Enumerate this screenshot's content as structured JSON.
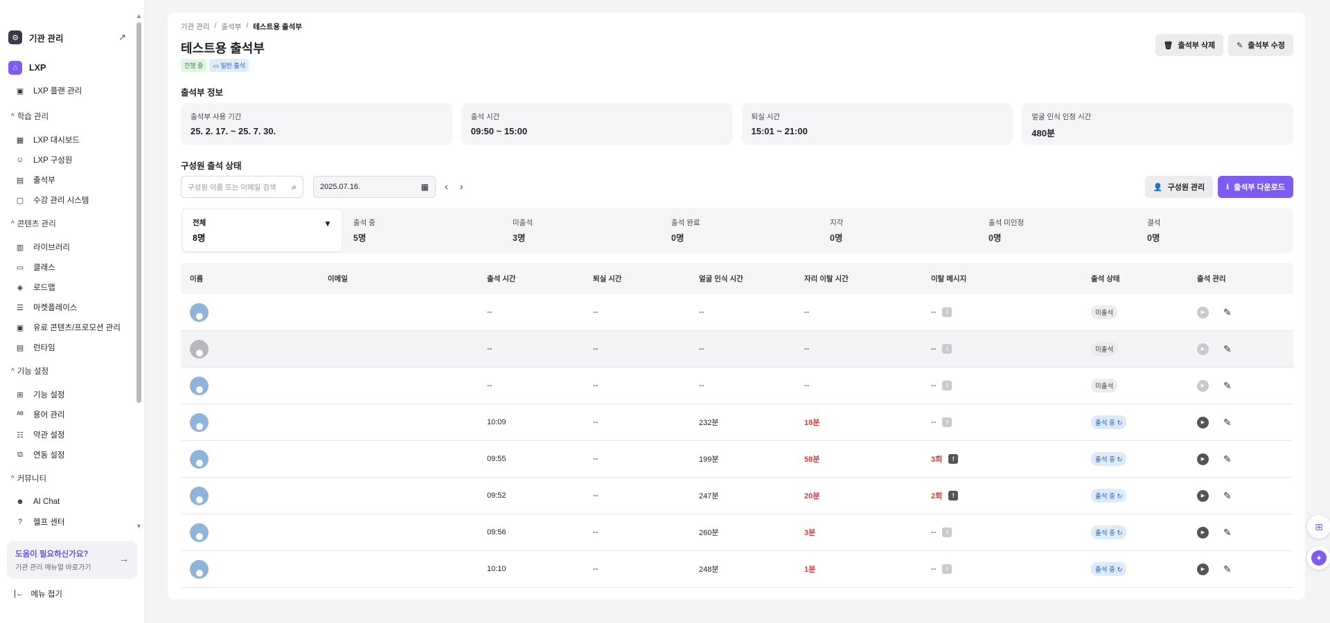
{
  "sidebar": {
    "org_title": "기관 관리",
    "lxp_title": "LXP",
    "lxp_plan": "LXP 플랜 관리",
    "sections": [
      {
        "title": "학습 관리",
        "items": [
          "LXP 대시보드",
          "LXP 구성원",
          "출석부",
          "수강 관리 시스템"
        ]
      },
      {
        "title": "콘텐츠 관리",
        "items": [
          "라이브러리",
          "클래스",
          "로드맵",
          "마켓플레이스",
          "유료 콘텐츠/프로모션 관리"
        ]
      },
      {
        "title": "기능 설정",
        "items": [
          "기능 설정",
          "용어 관리",
          "약관 설정",
          "연동 설정"
        ]
      },
      {
        "title": "커뮤니티",
        "items": [
          "AI Chat",
          "헬프 센터"
        ]
      }
    ],
    "help_title": "도움이 필요하신가요?",
    "help_sub": "기관 관리 매뉴얼 바로가기",
    "collapse_label": "메뉴 접기"
  },
  "breadcrumb": [
    "기관 관리",
    "출석부",
    "테스트용 출석부"
  ],
  "page_title": "테스트용 출석부",
  "badges": [
    "진행 중",
    "일반 출석"
  ],
  "top_buttons": {
    "delete": "출석부 삭제",
    "edit": "출석부 수정"
  },
  "info": {
    "section_title": "출석부 정보",
    "cards": [
      {
        "label": "출석부 사용 기간",
        "value": "25. 2. 17. ~ 25. 7. 30."
      },
      {
        "label": "출석 시간",
        "value": "09:50 ~ 15:00"
      },
      {
        "label": "퇴실 시간",
        "value": "15:01 ~ 21:00"
      },
      {
        "label": "얼굴 인식 인정 시간",
        "value": "480분"
      }
    ]
  },
  "members": {
    "section_title": "구성원 출석 상태",
    "search_placeholder": "구성원 이름 또는 이메일 검색",
    "date": "2025.07.16.",
    "btn_manage": "구성원 관리",
    "btn_download": "출석부 다운로드"
  },
  "filters": [
    {
      "label": "전체",
      "value": "8명"
    },
    {
      "label": "출석 중",
      "value": "5명"
    },
    {
      "label": "미출석",
      "value": "3명"
    },
    {
      "label": "출석 완료",
      "value": "0명"
    },
    {
      "label": "지각",
      "value": "0명"
    },
    {
      "label": "출석 미인정",
      "value": "0명"
    },
    {
      "label": "결석",
      "value": "0명"
    }
  ],
  "table": {
    "headers": [
      "이름",
      "이메일",
      "출석 시간",
      "퇴실 시간",
      "얼굴 인식 시간",
      "자리 이탈 시간",
      "이탈 메시지",
      "출석 상태",
      "출석 관리"
    ],
    "rows": [
      {
        "checkin": "--",
        "checkout": "--",
        "face": "--",
        "away": "--",
        "msg": "--",
        "status": "미출석"
      },
      {
        "checkin": "--",
        "checkout": "--",
        "face": "--",
        "away": "--",
        "msg": "--",
        "status": "미출석"
      },
      {
        "checkin": "--",
        "checkout": "--",
        "face": "--",
        "away": "--",
        "msg": "--",
        "status": "미출석"
      },
      {
        "checkin": "10:09",
        "checkout": "--",
        "face": "232분",
        "away": "18분",
        "msg": "--",
        "status": "출석 중"
      },
      {
        "checkin": "09:55",
        "checkout": "--",
        "face": "199분",
        "away": "58분",
        "msg": "3회",
        "status": "출석 중"
      },
      {
        "checkin": "09:52",
        "checkout": "--",
        "face": "247분",
        "away": "20분",
        "msg": "2회",
        "status": "출석 중"
      },
      {
        "checkin": "09:56",
        "checkout": "--",
        "face": "260분",
        "away": "3분",
        "msg": "--",
        "status": "출석 중"
      },
      {
        "checkin": "10:10",
        "checkout": "--",
        "face": "248분",
        "away": "1분",
        "msg": "--",
        "status": "출석 중"
      }
    ]
  },
  "colors": {
    "accent": "#7c5cf1",
    "danger": "#d63b3b"
  }
}
